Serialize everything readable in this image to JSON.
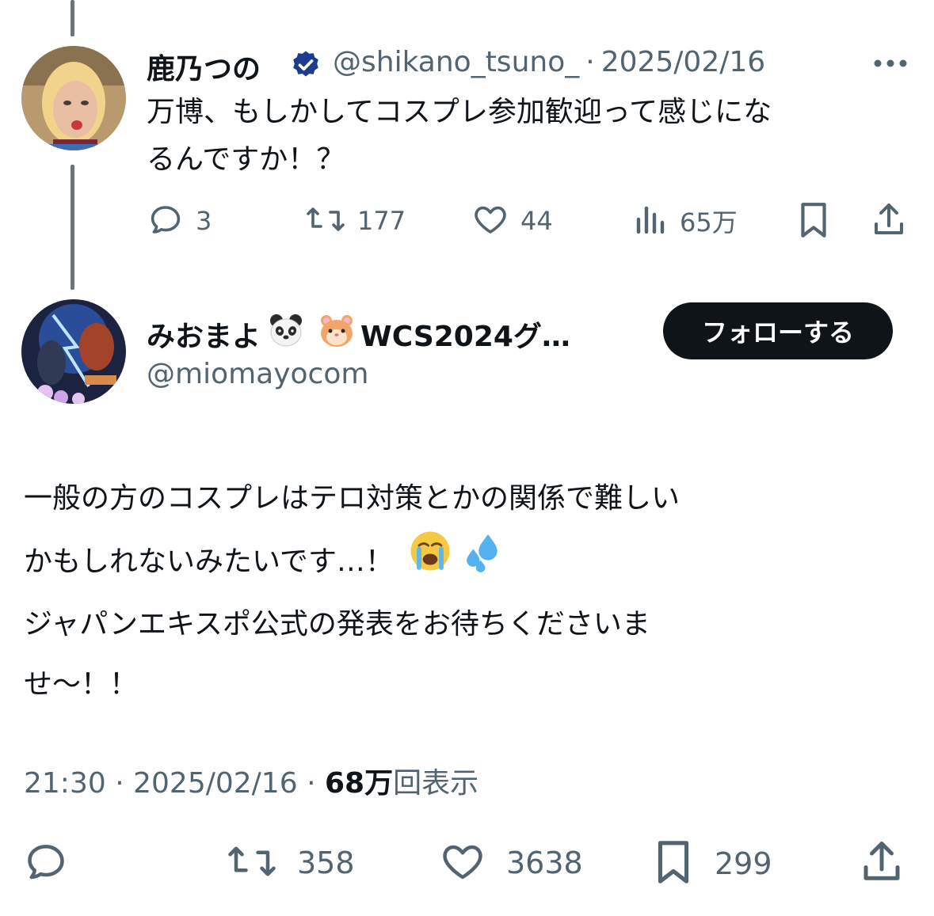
{
  "parent_tweet": {
    "display_name": "鹿乃つの",
    "handle": "@shikano_tsuno_",
    "separator": "·",
    "date": "2025/02/16",
    "more_label": "•••",
    "text_line1": "万博、もしかしてコスプレ参加歓迎って感じにな",
    "text_line2": "るんですか！？",
    "replies": "3",
    "reposts": "177",
    "likes": "44",
    "views": "65万",
    "verified": true
  },
  "main_tweet": {
    "display_name": "みおまよ",
    "name_suffix": "WCS2024グ…",
    "handle": "@miomayocom",
    "follow_label": "フォローする",
    "text_line1": "一般の方のコスプレはテロ対策とかの関係で難しい",
    "text_line2": "かもしれないみたいです…！",
    "text_line3": "ジャパンエキスポ公式の発表をお待ちくださいま",
    "text_line4": "せ〜！！",
    "time": "21:30",
    "sep1": "·",
    "date": "2025/02/16",
    "sep2": "·",
    "views_count": "68万",
    "views_label": "回表示",
    "reposts": "358",
    "likes": "3638",
    "bookmarks": "299"
  },
  "icons": [
    "reply-icon",
    "repost-icon",
    "like-icon",
    "views-icon",
    "bookmark-icon",
    "share-icon",
    "verified-badge-icon",
    "more-icon",
    "panda-emoji-icon",
    "hamster-emoji-icon",
    "crying-emoji-icon",
    "sweat-drops-emoji-icon"
  ],
  "colors": {
    "text": "#0f1419",
    "muted": "#536471",
    "verified": "#1d3c8f",
    "button_bg": "#0f1419",
    "thread_line": "#687480"
  }
}
